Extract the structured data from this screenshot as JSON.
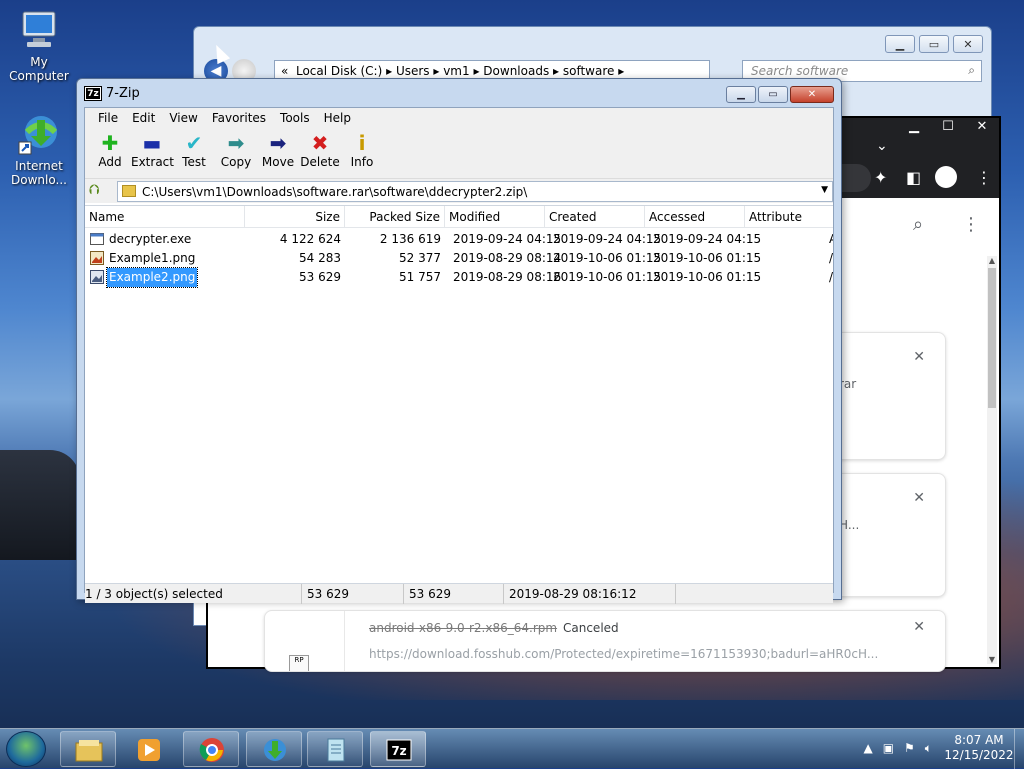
{
  "desktop": {
    "icons": [
      {
        "label": "My Computer"
      },
      {
        "label": "Internet Downlo..."
      }
    ]
  },
  "explorer": {
    "breadcrumb": [
      "«",
      "Local Disk (C:)",
      "Users",
      "vm1",
      "Downloads",
      "software"
    ],
    "search_placeholder": "Search software"
  },
  "chrome": {
    "downloads": [
      {
        "fragment": "rar"
      },
      {
        "fragment": "H..."
      },
      {
        "filename": "android-x86-9.0-r2.x86_64.rpm",
        "status": "Canceled",
        "url": "https://download.fosshub.com/Protected/expiretime=1671153930;badurl=aHR0cH..."
      }
    ],
    "file_icon_label": "RP"
  },
  "zip": {
    "title": "7-Zip",
    "app_icon": "7z",
    "menu": [
      "File",
      "Edit",
      "View",
      "Favorites",
      "Tools",
      "Help"
    ],
    "toolbar": [
      {
        "label": "Add",
        "icon": "plus-icon",
        "glyph": "✚",
        "color": "#1fb31f"
      },
      {
        "label": "Extract",
        "icon": "minus-icon",
        "glyph": "▬",
        "color": "#1a2fa8"
      },
      {
        "label": "Test",
        "icon": "check-icon",
        "glyph": "✔",
        "color": "#2ab6c8"
      },
      {
        "label": "Copy",
        "icon": "copy-arrow-icon",
        "glyph": "➡",
        "color": "#2e8c8c"
      },
      {
        "label": "Move",
        "icon": "move-arrow-icon",
        "glyph": "➡",
        "color": "#1a237e"
      },
      {
        "label": "Delete",
        "icon": "delete-x-icon",
        "glyph": "✖",
        "color": "#d41e1e"
      },
      {
        "label": "Info",
        "icon": "info-icon",
        "glyph": "i",
        "color": "#c89a00"
      }
    ],
    "path": "C:\\Users\\vm1\\Downloads\\software.rar\\software\\ddecrypter2.zip\\",
    "columns": [
      "Name",
      "Size",
      "Packed Size",
      "Modified",
      "Created",
      "Accessed",
      "Attribute"
    ],
    "files": [
      {
        "name": "decrypter.exe",
        "size": "4 122 624",
        "packed": "2 136 619",
        "modified": "2019-09-24 04:15",
        "created": "2019-09-24 04:15",
        "accessed": "2019-09-24 04:15",
        "attr": "A",
        "selected": false
      },
      {
        "name": "Example1.png",
        "size": "54 283",
        "packed": "52 377",
        "modified": "2019-08-29 08:14",
        "created": "2019-10-06 01:15",
        "accessed": "2019-10-06 01:15",
        "attr": "/",
        "selected": false
      },
      {
        "name": "Example2.png",
        "size": "53 629",
        "packed": "51 757",
        "modified": "2019-08-29 08:16",
        "created": "2019-10-06 01:15",
        "accessed": "2019-10-06 01:15",
        "attr": "/",
        "selected": true
      }
    ],
    "status": {
      "selection": "1 / 3 object(s) selected",
      "size": "53 629",
      "packed": "53 629",
      "modified": "2019-08-29 08:16:12"
    }
  },
  "taskbar": {
    "apps": [
      "file-explorer-icon",
      "media-player-icon",
      "chrome-icon",
      "internet-download-manager-icon",
      "notepad-icon",
      "7zip-icon"
    ],
    "time": "8:07 AM",
    "date": "12/15/2022"
  }
}
